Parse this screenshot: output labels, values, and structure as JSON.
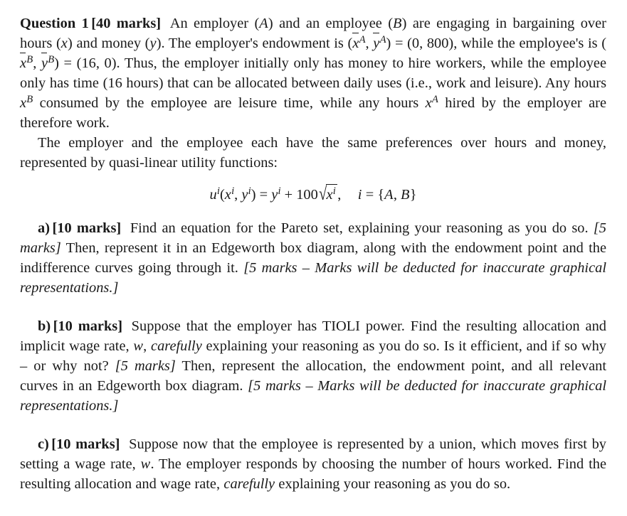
{
  "document": {
    "kind": "exam-question",
    "page_background": "#ffffff",
    "text_color": "#1a1a1a"
  },
  "question": {
    "heading_bold_title": "Question 1",
    "heading_bold_marks": "[40 marks]",
    "intro": {
      "s1_a": "An employer (",
      "s1_A": "A",
      "s1_b": ") and an employee (",
      "s1_B": "B",
      "s1_c": ") are engaging in bargaining over hours (",
      "s1_x": "x",
      "s1_d": ") and money (",
      "s1_y": "y",
      "s1_e": "). The employer's endowment is (",
      "end_A_x": "x",
      "end_A_x_sup": "A",
      "end_A_comma": ", ",
      "end_A_y": "y",
      "end_A_y_sup": "A",
      "end_A_eq": ") = (0, 800)",
      "s1_f": ", while the employee's is (",
      "end_B_x": "x",
      "end_B_x_sup": "B",
      "end_B_comma": ", ",
      "end_B_y": "y",
      "end_B_y_sup": "B",
      "end_B_eq": ") = (16, 0)",
      "s1_g": ". Thus, the employer initially only has money to hire workers, while the employee only has time (16 hours) that can be allocated between daily uses (i.e., work and leisure). Any hours ",
      "xB_var": "x",
      "xB_sup": "B",
      "s1_h": " consumed by the employee are leisure time, while any hours ",
      "xA_var": "x",
      "xA_sup": "A",
      "s1_i": " hired by the employer are therefore work."
    },
    "prefs_para": "The employer and the employee each have the same preferences over hours and money, represented by quasi-linear utility functions:",
    "equation": {
      "latex": "u^i(x^i, y^i) = y^i + 100\\sqrt{x^i}, \\quad i = \\{A, B\\}",
      "u": "u",
      "u_sup": "i",
      "open": "(",
      "x": "x",
      "x_sup": "i",
      "comma": ", ",
      "y": "y",
      "y_sup": "i",
      "close": ") = ",
      "y2": "y",
      "y2_sup": "i",
      "plus": " + ",
      "hundred": "100",
      "radical": "√",
      "rad_x": "x",
      "rad_x_sup": "i",
      "trailing_comma": ",",
      "i_var": "i",
      "i_eq": " = {",
      "set_A": "A",
      "set_comma": ", ",
      "set_B": "B",
      "set_close": "}"
    },
    "parts": [
      {
        "label": "a)",
        "marks": "[10 marks]",
        "t1": "Find an equation for the Pareto set, explaining your reasoning as you do so. ",
        "i1": "[5 marks]",
        "t2": " Then, represent it in an Edgeworth box diagram, along with the endowment point and the indifference curves going through it. ",
        "i2": "[5 marks – Marks will be deducted for inaccurate graphical representations.]"
      },
      {
        "label": "b)",
        "marks": "[10 marks]",
        "t1": "Suppose that the employer has TIOLI power. Find the resulting allocation and implicit wage rate, ",
        "w_var": "w",
        "t2": ", ",
        "i_carefully": "carefully",
        "t3": " explaining your reasoning as you do so. Is it efficient, and if so why – or why not? ",
        "i1": "[5 marks]",
        "t4": " Then, represent the allocation, the endowment point, and all relevant curves in an Edgeworth box diagram. ",
        "i2": "[5 marks – Marks will be deducted for inaccurate graphical representations.]"
      },
      {
        "label": "c)",
        "marks": "[10 marks]",
        "t1": "Suppose now that the employee is represented by a union, which moves first by setting a wage rate, ",
        "w_var": "w",
        "t2": ". The employer responds by choosing the number of hours worked. Find the resulting allocation and wage rate, ",
        "i_carefully": "carefully",
        "t3": " explaining your reasoning as you do so."
      }
    ]
  }
}
